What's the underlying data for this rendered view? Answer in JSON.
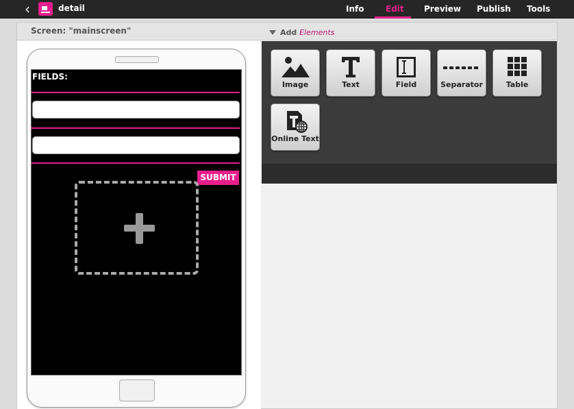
{
  "topbar": {
    "back_glyph": "‹",
    "app_title": "detail",
    "tabs": [
      {
        "label": "Info",
        "active": false
      },
      {
        "label": "Edit",
        "active": true
      },
      {
        "label": "Preview",
        "active": false
      },
      {
        "label": "Publish",
        "active": false
      },
      {
        "label": "Tools",
        "active": false
      }
    ]
  },
  "editor": {
    "screen_label": "Screen: \"mainscreen\"",
    "add_label": "Add",
    "add_elements": "Elements"
  },
  "phone": {
    "fields_label": "FIELDS:",
    "field_1_value": "",
    "field_2_value": "",
    "submit_label": "SUBMIT"
  },
  "tools": [
    {
      "label": "Image",
      "icon": "image-icon"
    },
    {
      "label": "Text",
      "icon": "text-icon"
    },
    {
      "label": "Field",
      "icon": "field-icon"
    },
    {
      "label": "Separator",
      "icon": "separator-icon"
    },
    {
      "label": "Table",
      "icon": "table-icon"
    },
    {
      "label": "Online Text",
      "icon": "online-text-icon"
    }
  ],
  "colors": {
    "accent": "#e91e8c",
    "topbar": "#262626",
    "panel": "#3b3b3b"
  }
}
